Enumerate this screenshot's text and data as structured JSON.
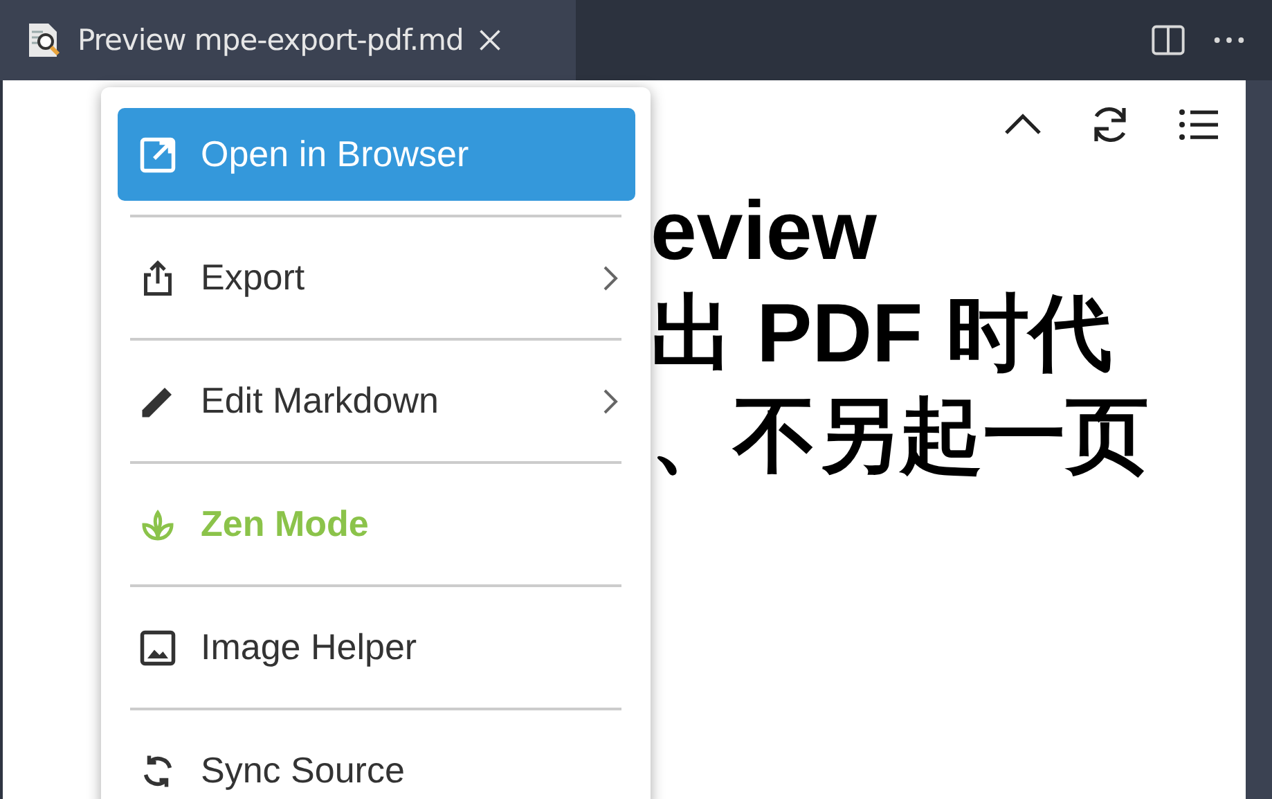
{
  "tab": {
    "title": "Preview mpe-export-pdf.md",
    "selected": true
  },
  "document": {
    "heading_lines": [
      "eview",
      "出 PDF 时代",
      "、不另起一页"
    ]
  },
  "menu": {
    "items": [
      {
        "label": "Open in Browser",
        "kind": "action",
        "selected": true,
        "submenu": false
      },
      {
        "label": "Export",
        "kind": "action",
        "selected": false,
        "submenu": true
      },
      {
        "label": "Edit Markdown",
        "kind": "action",
        "selected": false,
        "submenu": true
      },
      {
        "label": "Zen Mode",
        "kind": "toggle",
        "on": true,
        "selected": false,
        "submenu": false
      },
      {
        "label": "Image Helper",
        "kind": "action",
        "selected": false,
        "submenu": false
      },
      {
        "label": "Sync Source",
        "kind": "action",
        "selected": false,
        "submenu": false
      }
    ]
  }
}
